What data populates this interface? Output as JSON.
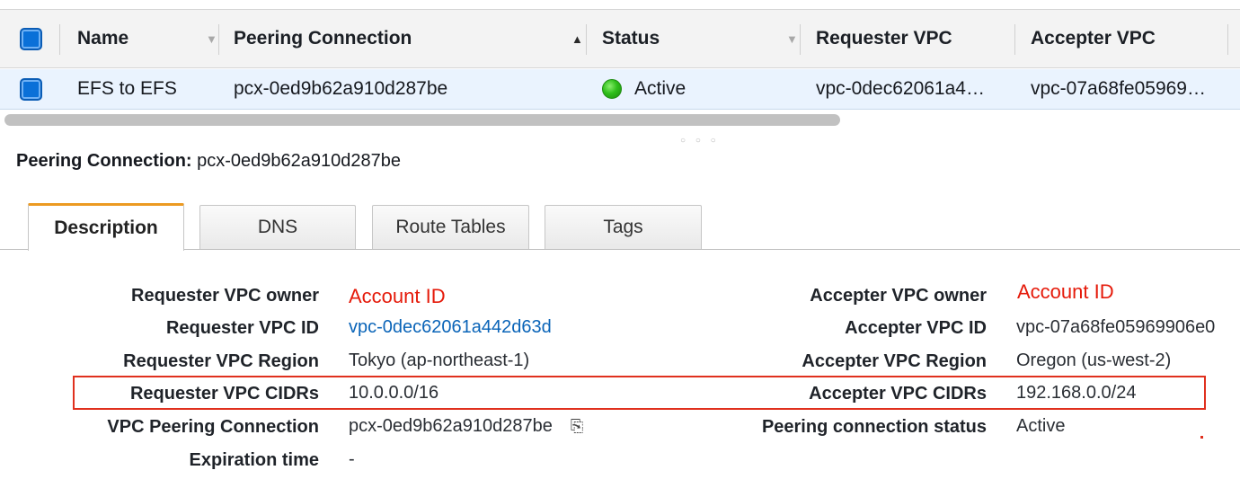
{
  "table": {
    "headers": {
      "name": "Name",
      "peering_connection": "Peering Connection",
      "status": "Status",
      "requester_vpc": "Requester VPC",
      "accepter_vpc": "Accepter VPC"
    },
    "sort_icons": {
      "name": "▼",
      "peering_connection": "▲",
      "status": "▼"
    },
    "row": {
      "name": "EFS to EFS",
      "peering_connection": "pcx-0ed9b62a910d287be",
      "status": "Active",
      "requester_vpc": "vpc-0dec62061a4…",
      "accepter_vpc": "vpc-07a68fe05969…"
    }
  },
  "splitter_glyph": "○ ○ ○",
  "detail": {
    "title_label": "Peering Connection:",
    "title_value": "pcx-0ed9b62a910d287be"
  },
  "tabs": [
    "Description",
    "DNS",
    "Route Tables",
    "Tags"
  ],
  "description": {
    "left": [
      {
        "label": "Requester VPC owner",
        "value": "Account ID"
      },
      {
        "label": "Requester VPC ID",
        "value": "vpc-0dec62061a442d63d"
      },
      {
        "label": "Requester VPC Region",
        "value": "Tokyo (ap-northeast-1)"
      },
      {
        "label": "Requester VPC CIDRs",
        "value": "10.0.0.0/16"
      },
      {
        "label": "VPC Peering Connection",
        "value": "pcx-0ed9b62a910d287be"
      },
      {
        "label": "Expiration time",
        "value": "-"
      }
    ],
    "right": [
      {
        "label": "Accepter VPC owner",
        "value": "Account ID"
      },
      {
        "label": "Accepter VPC ID",
        "value": "vpc-07a68fe05969906e0"
      },
      {
        "label": "Accepter VPC Region",
        "value": "Oregon (us-west-2)"
      },
      {
        "label": "Accepter VPC CIDRs",
        "value": "192.168.0.0/24"
      },
      {
        "label": "Peering connection status",
        "value": "Active"
      }
    ],
    "copy_glyph": "⎘"
  },
  "colors": {
    "accent": "#0a70d8",
    "active_tab": "#ec9a22",
    "status_active": "#2fbf1b",
    "annotation_red": "#e0301e"
  }
}
